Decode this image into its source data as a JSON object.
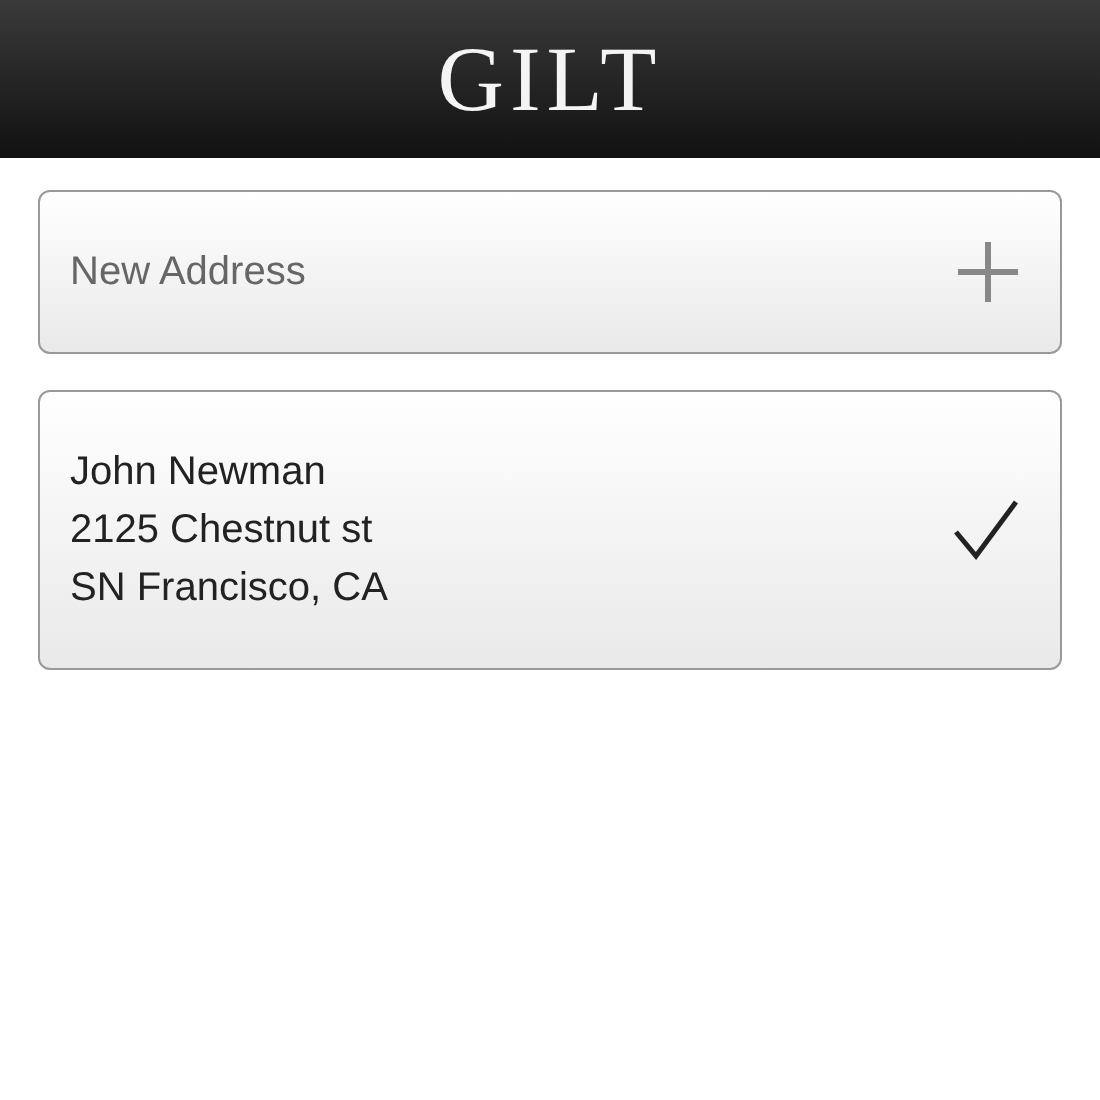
{
  "header": {
    "logo": "GILT"
  },
  "new_address": {
    "label": "New Address"
  },
  "addresses": [
    {
      "lines": [
        "John Newman",
        "2125 Chestnut st",
        "SN Francisco, CA"
      ],
      "selected": true
    }
  ]
}
